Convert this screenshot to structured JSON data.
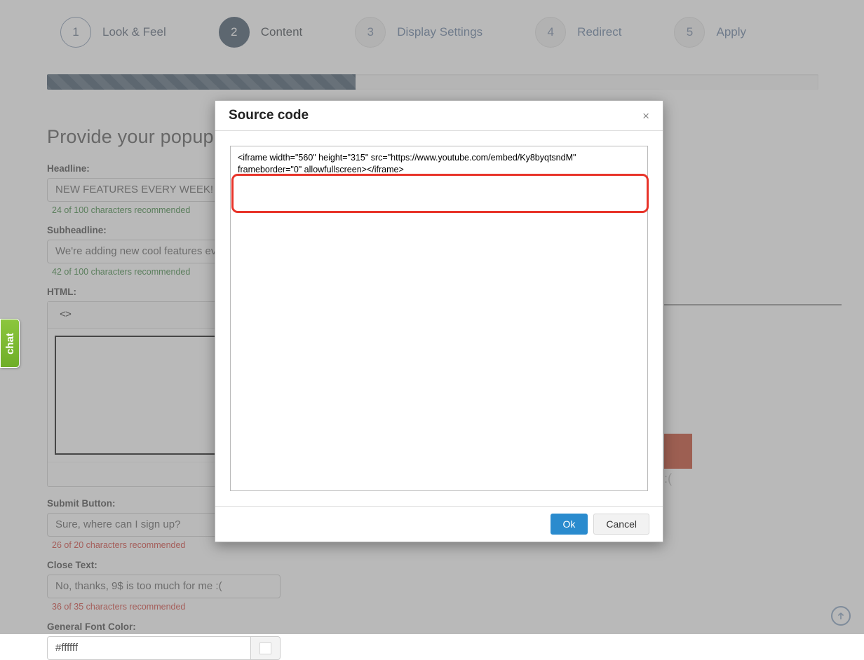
{
  "wizard": {
    "steps": [
      {
        "number": "1",
        "label": "Look & Feel",
        "state": "done"
      },
      {
        "number": "2",
        "label": "Content",
        "state": "active"
      },
      {
        "number": "3",
        "label": "Display Settings",
        "state": "pending"
      },
      {
        "number": "4",
        "label": "Redirect",
        "state": "pending"
      },
      {
        "number": "5",
        "label": "Apply",
        "state": "pending"
      }
    ]
  },
  "progress": {
    "percent": 40
  },
  "form": {
    "heading": "Provide your popup co",
    "headline": {
      "label": "Headline:",
      "value": "NEW FEATURES EVERY WEEK!",
      "help": "24 of 100 characters recommended",
      "help_state": "ok"
    },
    "subheadline": {
      "label": "Subheadline:",
      "value": "We're adding new cool features ev",
      "help": "42 of 100 characters recommended",
      "help_state": "ok"
    },
    "html": {
      "label": "HTML:",
      "toolbar_source_label": "<>"
    },
    "submit_button": {
      "label": "Submit Button:",
      "value": "Sure, where can I sign up?",
      "help": "26 of 20 characters recommended",
      "help_state": "bad"
    },
    "close_text": {
      "label": "Close Text:",
      "value": "No, thanks, 9$ is too much for me :(",
      "help": "36 of 35 characters recommended",
      "help_state": "bad"
    },
    "font_color": {
      "label": "General Font Color:",
      "value": "#ffffff",
      "swatch": "#ffffff"
    }
  },
  "preview": {
    "sad_face": ":("
  },
  "chat": {
    "label": "chat"
  },
  "modal": {
    "title": "Source code",
    "close_label": "×",
    "code": "<iframe width=\"560\" height=\"315\" src=\"https://www.youtube.com/embed/Ky8byqtsndM\" frameborder=\"0\" allowfullscreen></iframe>",
    "ok_label": "Ok",
    "cancel_label": "Cancel"
  },
  "colors": {
    "accent_blue": "#2a8bce",
    "step_active": "#34495e",
    "highlight_red": "#e8342a",
    "chat_green": "#8cc63e",
    "preview_orange": "#c0391b",
    "help_ok": "#2e7d32",
    "help_bad": "#d0342c"
  }
}
